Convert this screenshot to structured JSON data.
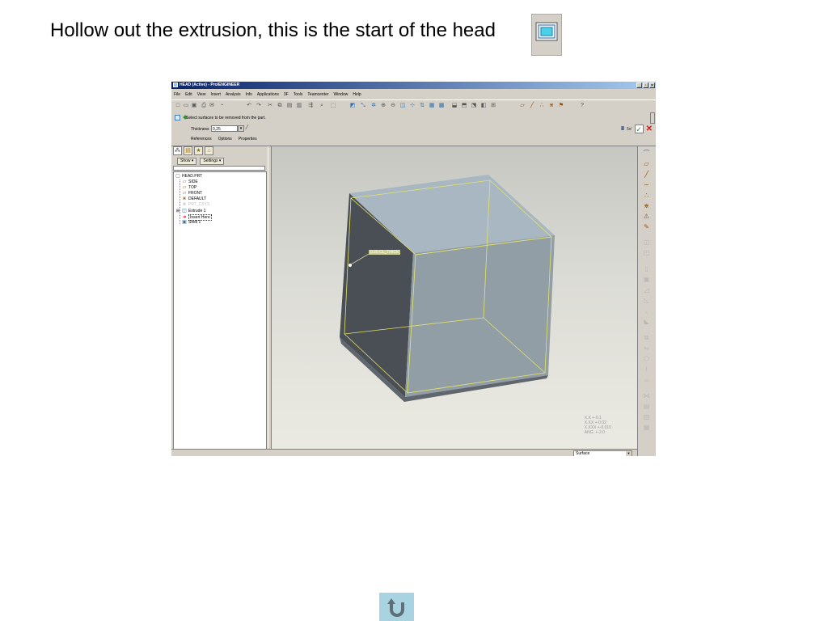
{
  "slide": {
    "title": "Hollow out the extrusion, this is the start of the head"
  },
  "window": {
    "title": "HEAD (Active) - Pro/ENGINEER",
    "buttons": [
      "_",
      "·",
      "×"
    ]
  },
  "menu": [
    "File",
    "Edit",
    "View",
    "Insert",
    "Analysis",
    "Info",
    "Applications",
    "3F",
    "Tools",
    "Teamcenter",
    "Window",
    "Help"
  ],
  "dashboard": {
    "message": "Select surfaces to be removed from the part.",
    "thickness_label": "Thickness",
    "thickness_value": "0,25",
    "tabs": [
      "References",
      "Options",
      "Properties"
    ],
    "preview_label": "δα'"
  },
  "model_tree": {
    "show_label": "Show ▾",
    "settings_label": "Settings ▾",
    "items": [
      {
        "label": "HEAD.PRT"
      },
      {
        "label": "SIDE"
      },
      {
        "label": "TOP"
      },
      {
        "label": "FRONT"
      },
      {
        "label": "DEFAULT"
      },
      {
        "label": "PRT_CSYS"
      },
      {
        "label": "Extrude 1"
      },
      {
        "label": "Insert Here"
      },
      {
        "label": "Shell 1"
      }
    ]
  },
  "graphics": {
    "thickness_tag": "0.25 CL_THICK",
    "stats": [
      "X.X +-0.1",
      "X.XX +-0.02",
      "X.XXX +-0.010",
      "ANG. +-2.0"
    ]
  },
  "status": {
    "selection_filter": "Surface"
  },
  "colors": {
    "titlebar": "#0a246a",
    "window_bg": "#d4d0c8",
    "cube_top": "#a7b6c0",
    "cube_front": "#939ea7",
    "cube_side": "#4b5057",
    "edge_highlight": "#e3e36a",
    "return_button": "#a9d3e0"
  },
  "icons": {
    "shell": "shell-feature-icon",
    "return": "return-u-arrow-icon"
  }
}
